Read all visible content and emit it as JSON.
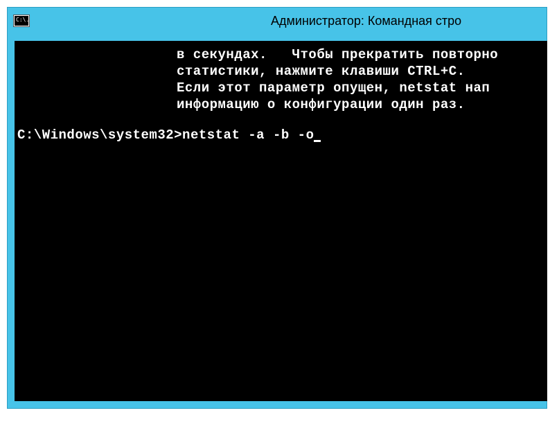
{
  "window": {
    "title": "Администратор: Командная стро",
    "icon_label": "C:\\."
  },
  "console": {
    "lines": [
      "в секундах.   Чтобы прекратить повторно",
      "статистики, нажмите клавиши CTRL+C.",
      "Если этот параметр опущен, netstat нап",
      "информацию о конфигурации один раз."
    ],
    "prompt": "C:\\Windows\\system32>",
    "command": "netstat -a -b -o"
  }
}
